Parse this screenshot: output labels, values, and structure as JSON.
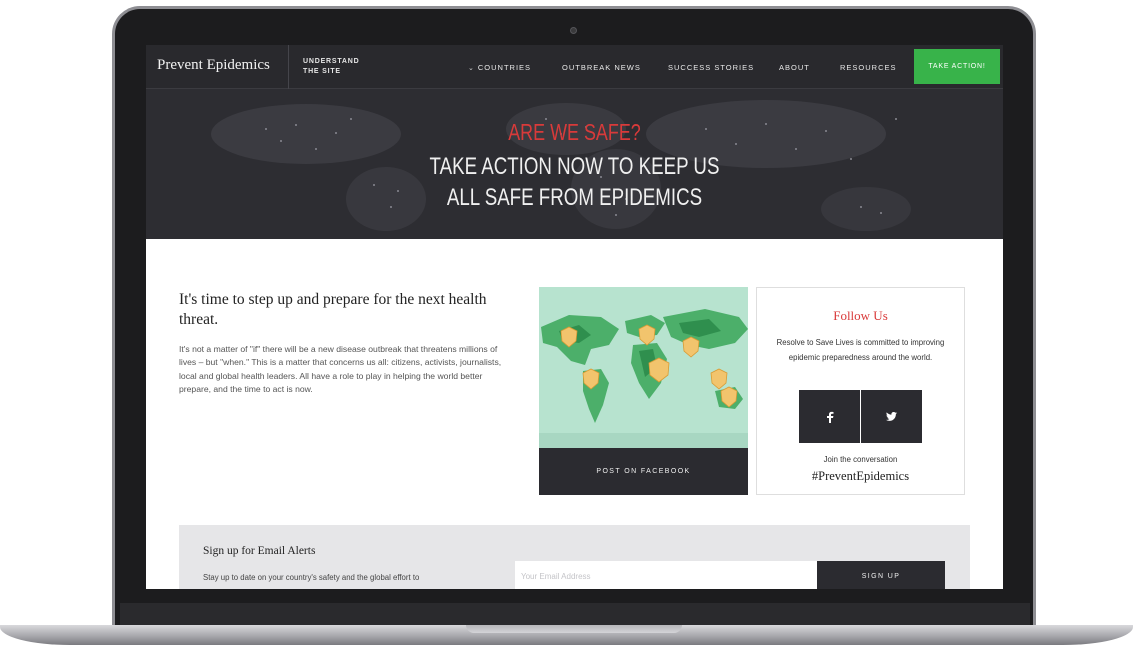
{
  "nav": {
    "logo": "Prevent Epidemics",
    "understand_line1": "UNDERSTAND",
    "understand_line2": "THE SITE",
    "items": [
      {
        "label": "COUNTRIES",
        "icon": "chevron-down-icon"
      },
      {
        "label": "OUTBREAK NEWS"
      },
      {
        "label": "SUCCESS STORIES"
      },
      {
        "label": "ABOUT"
      },
      {
        "label": "RESOURCES"
      }
    ],
    "cta": "TAKE ACTION!"
  },
  "hero": {
    "kicker": "ARE WE SAFE?",
    "line1": "TAKE ACTION NOW TO KEEP US",
    "line2": "ALL SAFE FROM EPIDEMICS"
  },
  "intro": {
    "title": "It's time to step up and prepare for the next health threat.",
    "body": "It's not a matter of \"if\" there will be a new disease outbreak that threatens millions of lives – but \"when.\" This is a matter that concerns us all: citizens, activists, journalists, local and global health leaders. All have a role to play in helping the world better prepare, and the time to act is now."
  },
  "map_card": {
    "button": "POST ON FACEBOOK",
    "image": "world-map-shields"
  },
  "follow": {
    "title": "Follow Us",
    "description": "Resolve to Save Lives is committed to improving epidemic preparedness around the world.",
    "facebook_icon": "facebook-icon",
    "twitter_icon": "twitter-icon",
    "join": "Join the conversation",
    "hashtag": "#PreventEpidemics"
  },
  "alerts": {
    "title": "Sign up for Email Alerts",
    "description": "Stay up to date on your country's safety and the global effort to",
    "email_placeholder": "Your Email Address",
    "button": "SIGN UP"
  },
  "colors": {
    "nav_bg": "#29292d",
    "accent_red": "#d93a3a",
    "cta_green": "#38b34a",
    "dark_button": "#2b2b30",
    "map_water": "#b7e3cf"
  }
}
